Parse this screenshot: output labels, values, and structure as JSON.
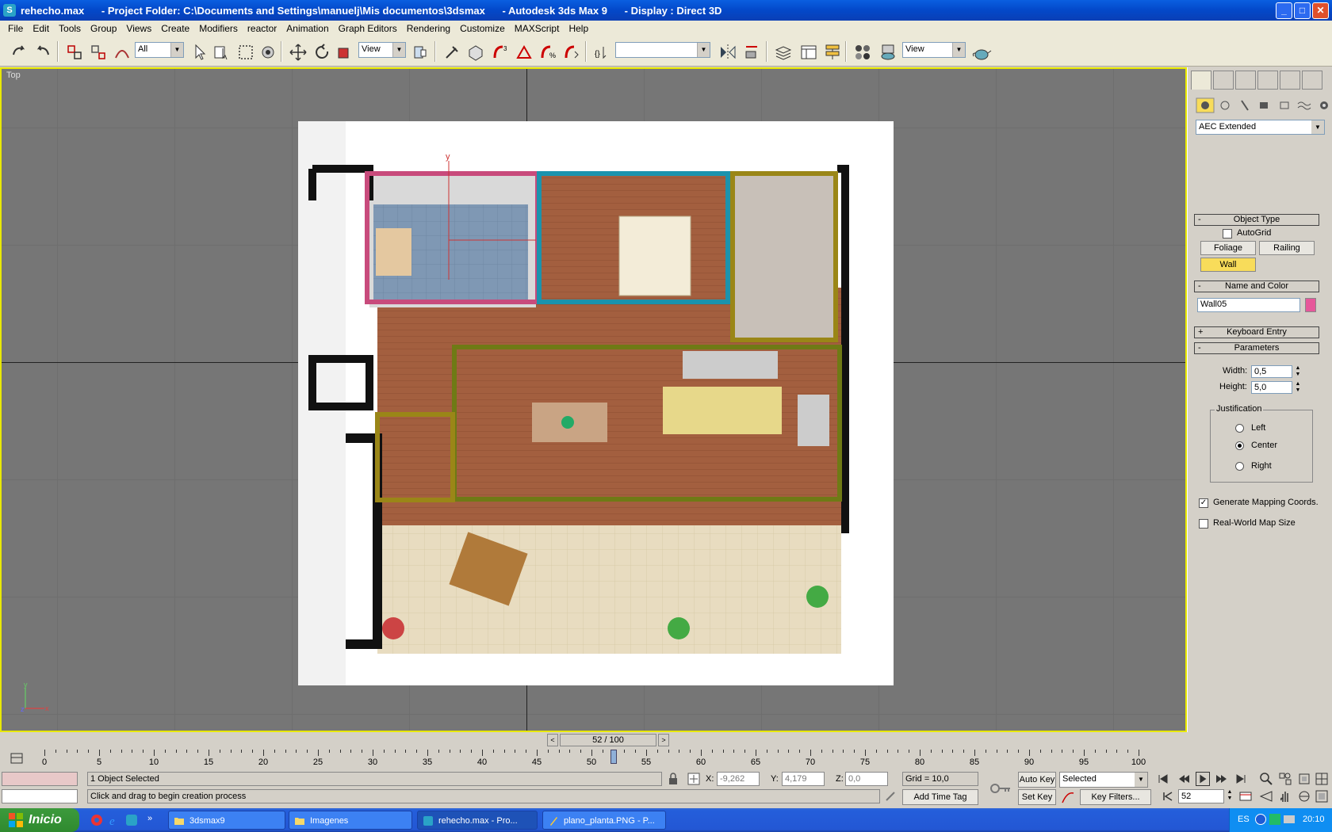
{
  "window": {
    "title": "rehecho.max      - Project Folder: C:\\Documents and Settings\\manuelj\\Mis documentos\\3dsmax      - Autodesk 3ds Max 9      - Display : Direct 3D",
    "min": "_",
    "max": "□",
    "close": "✕"
  },
  "menu": [
    "File",
    "Edit",
    "Tools",
    "Group",
    "Views",
    "Create",
    "Modifiers",
    "reactor",
    "Animation",
    "Graph Editors",
    "Rendering",
    "Customize",
    "MAXScript",
    "Help"
  ],
  "toolbar": {
    "selection_filter": "All",
    "ref_coord": "View",
    "named_sel": "",
    "ref_coord2": "View"
  },
  "viewport": {
    "label": "Top",
    "gizmo_y": "y",
    "gizmo_x": "x",
    "gizmo_z": "z",
    "object_axis": "y"
  },
  "command_panel": {
    "category": "AEC Extended",
    "object_type": {
      "header": "Object Type",
      "autogrid": "AutoGrid",
      "buttons": [
        "Foliage",
        "Railing",
        "Wall"
      ],
      "active": "Wall"
    },
    "name_color": {
      "header": "Name and Color",
      "name": "Wall05",
      "color": "#e6579a"
    },
    "keyboard_entry": {
      "header": "Keyboard Entry"
    },
    "parameters": {
      "header": "Parameters",
      "width_label": "Width:",
      "width_value": "0,5",
      "height_label": "Height:",
      "height_value": "5,0",
      "justification": "Justification",
      "options": [
        "Left",
        "Center",
        "Right"
      ],
      "selected": "Center",
      "gen_mapping": "Generate Mapping Coords.",
      "real_world": "Real-World Map Size"
    }
  },
  "time": {
    "frame_display": "52 / 100",
    "ticks": [
      "0",
      "5",
      "10",
      "15",
      "20",
      "25",
      "30",
      "35",
      "40",
      "45",
      "50",
      "55",
      "60",
      "65",
      "70",
      "75",
      "80",
      "85",
      "90",
      "95",
      "100"
    ],
    "current_frame": 52
  },
  "status": {
    "selected": "1 Object Selected",
    "prompt": "Click and drag to begin creation process",
    "x_label": "X:",
    "x_value": "-9,262",
    "y_label": "Y:",
    "y_value": "4,179",
    "z_label": "Z:",
    "z_value": "0,0",
    "grid": "Grid = 10,0",
    "add_time_tag": "Add Time Tag",
    "auto_key": "Auto Key",
    "set_key": "Set Key",
    "key_mode": "Selected",
    "key_filters": "Key Filters...",
    "frame_spinner": "52"
  },
  "taskbar": {
    "start": "Inicio",
    "tasks": [
      {
        "label": "3dsmax9",
        "active": false
      },
      {
        "label": "Imagenes",
        "active": false
      },
      {
        "label": "rehecho.max     - Pro...",
        "active": true
      },
      {
        "label": "plano_planta.PNG - P...",
        "active": false
      }
    ],
    "lang": "ES",
    "clock": "20:10"
  }
}
